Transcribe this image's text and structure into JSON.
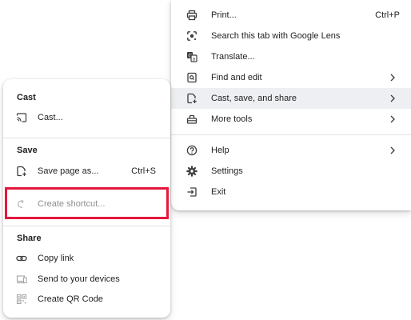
{
  "main_menu": {
    "items": [
      {
        "label": "Print...",
        "shortcut": "Ctrl+P",
        "icon": "print-icon"
      },
      {
        "label": "Search this tab with Google Lens",
        "icon": "google-lens-icon"
      },
      {
        "label": "Translate...",
        "icon": "translate-icon"
      },
      {
        "label": "Find and edit",
        "icon": "find-edit-icon",
        "submenu": true
      },
      {
        "label": "Cast, save, and share",
        "icon": "cast-save-share-icon",
        "submenu": true,
        "highlighted": true
      },
      {
        "label": "More tools",
        "icon": "more-tools-icon",
        "submenu": true
      },
      {
        "label": "Help",
        "icon": "help-icon",
        "submenu": true
      },
      {
        "label": "Settings",
        "icon": "settings-icon"
      },
      {
        "label": "Exit",
        "icon": "exit-icon"
      }
    ]
  },
  "sub_menu": {
    "sections": [
      {
        "heading": "Cast",
        "items": [
          {
            "label": "Cast...",
            "icon": "cast-icon"
          }
        ]
      },
      {
        "heading": "Save",
        "items": [
          {
            "label": "Save page as...",
            "shortcut": "Ctrl+S",
            "icon": "save-page-icon"
          },
          {
            "label": "Create shortcut...",
            "icon": "shortcut-icon",
            "disabled": true
          }
        ]
      },
      {
        "heading": "Share",
        "items": [
          {
            "label": "Copy link",
            "icon": "link-icon"
          },
          {
            "label": "Send to your devices",
            "icon": "devices-icon",
            "disabled": true
          },
          {
            "label": "Create QR Code",
            "icon": "qr-code-icon",
            "disabled": true
          }
        ]
      }
    ]
  },
  "colors": {
    "highlight_row": "#eeeff2",
    "annotation_box": "#e5173a",
    "disabled_text": "#8e8e8e"
  }
}
